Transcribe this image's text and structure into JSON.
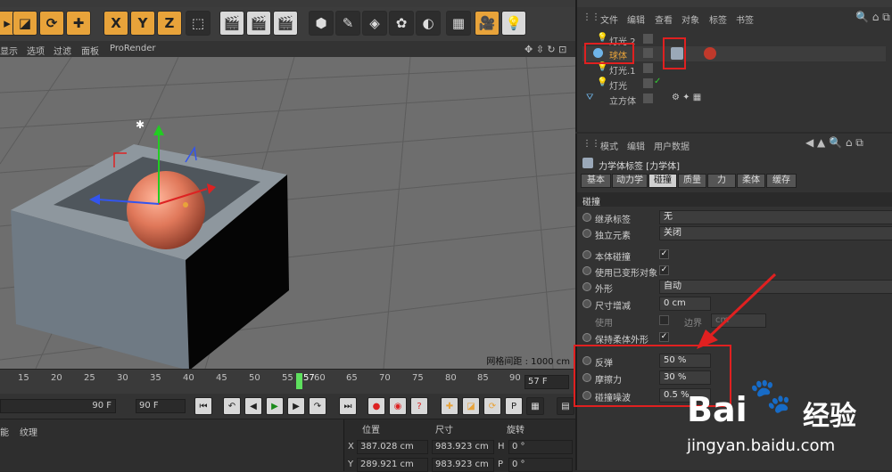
{
  "viewport_menu": {
    "items": [
      "显示",
      "选项",
      "过滤",
      "面板",
      "ProRender"
    ]
  },
  "viewport": {
    "grid_spacing": "网格间距 : 1000 cm"
  },
  "timeline": {
    "ticks": [
      "15",
      "20",
      "25",
      "30",
      "35",
      "40",
      "45",
      "50",
      "55",
      "57",
      "60",
      "65",
      "70",
      "75",
      "80",
      "85",
      "90"
    ],
    "current_frame": "57 F"
  },
  "playbar": {
    "end_frame_a": "90 F",
    "end_frame_b": "90 F"
  },
  "bottom": {
    "left_tabs": [
      "能",
      "纹理"
    ],
    "col_position": "位置",
    "col_size": "尺寸",
    "col_rotation": "旋转",
    "pos_x_label": "X",
    "pos_x": "387.028 cm",
    "pos_y_label": "Y",
    "pos_y": "289.921 cm",
    "size_x": "983.923 cm",
    "size_y": "983.923 cm",
    "rot_h_label": "H",
    "rot_h": "0 °",
    "rot_p_label": "P",
    "rot_p": "0 °"
  },
  "object_manager": {
    "menu": [
      "文件",
      "编辑",
      "查看",
      "对象",
      "标签",
      "书签"
    ],
    "objects": [
      {
        "name": "灯光.2"
      },
      {
        "name": "球体"
      },
      {
        "name": "灯光.1"
      },
      {
        "name": "灯光"
      },
      {
        "name": "立方体"
      }
    ]
  },
  "attribute_manager": {
    "menu": [
      "模式",
      "编辑",
      "用户数据"
    ],
    "tag_title": "力学体标签 [力学体]",
    "tabs": [
      "基本",
      "动力学",
      "碰撞",
      "质量",
      "力",
      "柔体",
      "缓存"
    ],
    "active_tab": "碰撞",
    "section": "碰撞",
    "props": {
      "inherit_label": "继承标签",
      "inherit_value": "无",
      "independent_label": "独立元素",
      "independent_value": "关闭",
      "self_collision_label": "本体碰撞",
      "use_deformed_label": "使用已变形对象",
      "shape_label": "外形",
      "shape_value": "自动",
      "size_increment_label": "尺寸增减",
      "size_increment_value": "0 cm",
      "use_label": "使用",
      "border_label": "边界",
      "border_value": "cm",
      "keep_soft_label": "保持柔体外形",
      "bounce_label": "反弹",
      "bounce_value": "50 %",
      "friction_label": "摩擦力",
      "friction_value": "30 %",
      "collision_noise_label": "碰撞噪波",
      "collision_noise_value": "0.5 %"
    }
  },
  "watermark": {
    "brand": "Bai",
    "brand2": "经验",
    "url": "jingyan.baidu.com"
  },
  "colors": {
    "highlight_red": "#e02020",
    "accent_orange": "#e8a33a",
    "sphere": "#e0785a",
    "box_top": "#8a949c"
  }
}
